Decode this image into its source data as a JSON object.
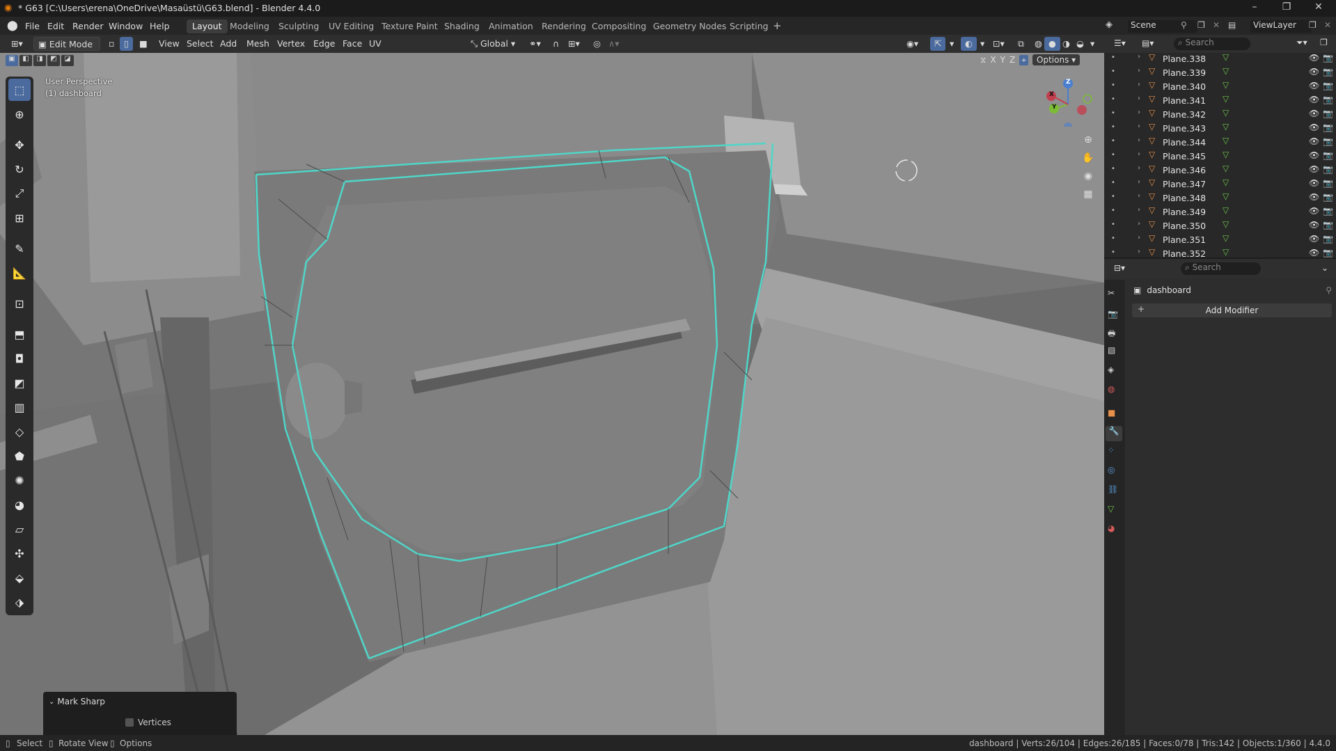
{
  "window": {
    "title": "* G63 [C:\\Users\\erena\\OneDrive\\Masaüstü\\G63.blend] - Blender 4.4.0",
    "controls": [
      "–",
      "❐",
      "✕"
    ]
  },
  "menu": [
    "File",
    "Edit",
    "Render",
    "Window",
    "Help"
  ],
  "workspaces": [
    "Layout",
    "Modeling",
    "Sculpting",
    "UV Editing",
    "Texture Paint",
    "Shading",
    "Animation",
    "Rendering",
    "Compositing",
    "Geometry Nodes",
    "Scripting"
  ],
  "active_workspace": "Layout",
  "scene": {
    "label": "Scene",
    "view_layer": "ViewLayer"
  },
  "viewport_header": {
    "mode": "Edit Mode",
    "menus": [
      "View",
      "Select",
      "Add",
      "Mesh",
      "Vertex",
      "Edge",
      "Face",
      "UV"
    ],
    "orientation": "Global",
    "options_label": "Options",
    "axes": [
      "X",
      "Y",
      "Z"
    ]
  },
  "viewport": {
    "perspective": "User Perspective",
    "object_label": "(1) dashboard",
    "selection_color": "#4fd6c8"
  },
  "gizmo": {
    "x": "X",
    "y": "Y",
    "z": "Z"
  },
  "last_operator": {
    "title": "Mark Sharp",
    "option_label": "Vertices",
    "checked": false
  },
  "outliner": {
    "search_placeholder": "Search",
    "items": [
      "Plane.338",
      "Plane.339",
      "Plane.340",
      "Plane.341",
      "Plane.342",
      "Plane.343",
      "Plane.344",
      "Plane.345",
      "Plane.346",
      "Plane.347",
      "Plane.348",
      "Plane.349",
      "Plane.350",
      "Plane.351",
      "Plane.352"
    ]
  },
  "properties": {
    "search_placeholder": "Search",
    "object_name": "dashboard",
    "add_modifier_label": "Add Modifier"
  },
  "statusbar": {
    "select": "Select",
    "rotate": "Rotate View",
    "options": "Options",
    "stats": "dashboard | Verts:26/104 | Edges:26/185 | Faces:0/78 | Tris:142 | Objects:1/360 | 4.4.0"
  }
}
